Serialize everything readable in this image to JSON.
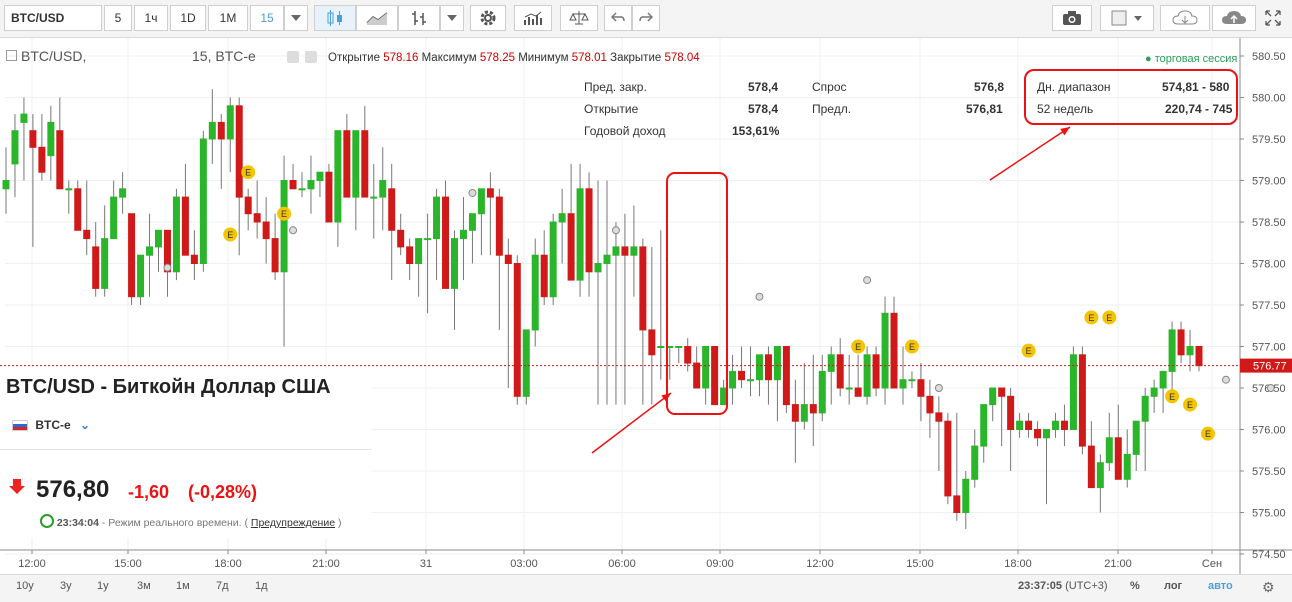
{
  "toolbar": {
    "symbol": "BTC/USD",
    "intervals": [
      "5",
      "1ч",
      "1D",
      "1M",
      "15"
    ],
    "selected_interval": "15",
    "icons": [
      "dropdown-icon",
      "candles-icon",
      "line-chart-icon",
      "bars-icon",
      "dropdown-icon",
      "settings-icon",
      "volume-icon",
      "compare-icon",
      "undo-icon",
      "redo-icon",
      "camera-icon",
      "color-square-icon",
      "cloud-load-icon",
      "cloud-save-icon",
      "fullscreen-icon"
    ]
  },
  "legend": {
    "name": "BTC/USD,",
    "interval_source": "15, BTC-e",
    "open_label": "Открытие",
    "open": "578.16",
    "high_label": "Максимум",
    "high": "578.25",
    "low_label": "Минимум",
    "low": "578.01",
    "close_label": "Закрытие",
    "close": "578.04",
    "session": "торговая сессия"
  },
  "stats": {
    "col1": [
      {
        "label": "Пред. закр.",
        "value": "578,4"
      },
      {
        "label": "Открытие",
        "value": "578,4"
      },
      {
        "label": "Годовой доход",
        "value": "153,61%"
      }
    ],
    "col2": [
      {
        "label": "Спрос",
        "value": "576,8"
      },
      {
        "label": "Предл.",
        "value": "576,81"
      }
    ],
    "col3": [
      {
        "label": "Дн. диапазон",
        "value": "574,81 - 580"
      },
      {
        "label": "52 недель",
        "value": "220,74 - 745"
      }
    ]
  },
  "info": {
    "title": "BTC/USD - Биткойн Доллар США",
    "exchange": "BTC-e",
    "price": "576,80",
    "change": "-1,60",
    "change_pct": "(-0,28%)",
    "time": "23:34:04",
    "status_text": "- Режим реального времени. (",
    "warning_link": "Предупреждение",
    "status_end": ")"
  },
  "chart_data": {
    "type": "candlestick",
    "y_ticks": [
      "580.50",
      "580.00",
      "579.50",
      "579.00",
      "578.50",
      "578.00",
      "577.50",
      "577.00",
      "576.50",
      "576.00",
      "575.50",
      "575.00",
      "574.50"
    ],
    "x_ticks": [
      "12:00",
      "15:00",
      "18:00",
      "21:00",
      "31",
      "03:00",
      "06:00",
      "09:00",
      "12:00",
      "15:00",
      "18:00",
      "21:00",
      "Сен"
    ],
    "last_price": "576.77",
    "ylim": [
      574.5,
      580.6
    ],
    "event_marker": "E",
    "candles": [
      [
        578.9,
        579.4,
        578.6,
        579.0
      ],
      [
        579.2,
        579.8,
        578.8,
        579.6
      ],
      [
        579.7,
        580.0,
        579.0,
        579.8
      ],
      [
        579.6,
        579.8,
        578.2,
        579.4
      ],
      [
        579.4,
        579.8,
        579.0,
        579.1
      ],
      [
        579.3,
        579.9,
        579.0,
        579.7
      ],
      [
        579.6,
        580.0,
        578.9,
        578.9
      ],
      [
        578.9,
        579.0,
        578.6,
        578.9
      ],
      [
        578.9,
        579.0,
        578.5,
        578.4
      ],
      [
        578.4,
        579.0,
        578.1,
        578.3
      ],
      [
        578.2,
        578.5,
        577.6,
        577.7
      ],
      [
        577.7,
        578.7,
        577.6,
        578.3
      ],
      [
        578.3,
        579.0,
        578.3,
        578.8
      ],
      [
        578.8,
        579.1,
        578.6,
        578.9
      ],
      [
        578.6,
        578.6,
        577.5,
        577.6
      ],
      [
        577.6,
        578.1,
        577.5,
        578.1
      ],
      [
        578.1,
        578.6,
        577.6,
        578.2
      ],
      [
        578.2,
        578.4,
        577.9,
        578.4
      ],
      [
        578.4,
        578.4,
        577.6,
        577.9
      ],
      [
        577.9,
        578.9,
        577.8,
        578.8
      ],
      [
        578.8,
        579.2,
        578.1,
        578.1
      ],
      [
        578.1,
        578.4,
        577.8,
        578.0
      ],
      [
        578.0,
        579.6,
        577.9,
        579.5
      ],
      [
        579.5,
        580.1,
        579.2,
        579.7
      ],
      [
        579.7,
        579.8,
        578.9,
        579.5
      ],
      [
        579.5,
        580.0,
        579.1,
        579.9
      ],
      [
        579.9,
        580.0,
        578.1,
        578.8
      ],
      [
        578.8,
        578.9,
        578.4,
        578.6
      ],
      [
        578.6,
        579.0,
        578.3,
        578.5
      ],
      [
        578.5,
        578.8,
        578.0,
        578.3
      ],
      [
        578.3,
        578.6,
        577.8,
        577.9
      ],
      [
        577.9,
        579.3,
        577.0,
        579.0
      ],
      [
        579.0,
        579.2,
        578.9,
        578.9
      ],
      [
        578.9,
        579.1,
        578.8,
        578.9
      ],
      [
        578.9,
        579.3,
        578.6,
        579.0
      ],
      [
        579.0,
        579.1,
        578.8,
        579.1
      ],
      [
        579.1,
        579.2,
        578.5,
        578.5
      ],
      [
        578.5,
        579.6,
        578.2,
        579.6
      ],
      [
        579.6,
        579.8,
        578.8,
        578.8
      ],
      [
        578.8,
        579.6,
        578.4,
        579.6
      ],
      [
        579.6,
        579.9,
        578.8,
        578.8
      ],
      [
        578.8,
        579.2,
        578.3,
        578.8
      ],
      [
        578.8,
        579.4,
        578.4,
        579.0
      ],
      [
        578.9,
        579.2,
        577.8,
        578.4
      ],
      [
        578.4,
        578.6,
        578.1,
        578.2
      ],
      [
        578.2,
        578.3,
        577.8,
        578.0
      ],
      [
        578.0,
        578.3,
        577.6,
        578.3
      ],
      [
        578.3,
        578.6,
        577.4,
        578.3
      ],
      [
        578.3,
        578.9,
        577.8,
        578.8
      ],
      [
        578.8,
        579.0,
        577.7,
        577.7
      ],
      [
        577.7,
        578.4,
        577.2,
        578.3
      ],
      [
        578.3,
        578.8,
        577.8,
        578.4
      ],
      [
        578.4,
        578.5,
        578.0,
        578.6
      ],
      [
        578.6,
        578.9,
        578.1,
        578.9
      ],
      [
        578.9,
        579.1,
        578.1,
        578.8
      ],
      [
        578.8,
        578.9,
        577.2,
        578.1
      ],
      [
        578.1,
        578.3,
        576.5,
        578.0
      ],
      [
        578.0,
        578.1,
        576.3,
        576.4
      ],
      [
        576.4,
        577.1,
        576.3,
        577.2
      ],
      [
        577.2,
        578.3,
        577.0,
        578.1
      ],
      [
        578.1,
        578.4,
        577.5,
        577.6
      ],
      [
        577.6,
        578.6,
        577.5,
        578.5
      ],
      [
        578.5,
        578.9,
        578.0,
        578.6
      ],
      [
        578.6,
        579.2,
        577.8,
        577.8
      ],
      [
        577.8,
        579.2,
        577.6,
        578.9
      ],
      [
        578.9,
        579.1,
        577.6,
        577.9
      ],
      [
        577.9,
        579.0,
        576.3,
        578.0
      ],
      [
        578.0,
        579.0,
        576.3,
        578.1
      ],
      [
        578.1,
        578.5,
        576.3,
        578.2
      ],
      [
        578.2,
        578.6,
        576.3,
        578.1
      ],
      [
        578.1,
        578.7,
        577.6,
        578.2
      ],
      [
        578.2,
        578.3,
        576.3,
        577.2
      ],
      [
        577.2,
        578.2,
        576.3,
        576.9
      ],
      [
        577.0,
        578.4,
        576.6,
        577.0
      ],
      [
        577.0,
        577.0,
        576.6,
        577.0
      ],
      [
        577.0,
        577.0,
        576.8,
        577.0
      ],
      [
        577.0,
        577.1,
        576.7,
        576.8
      ],
      [
        576.8,
        577.0,
        576.5,
        576.5
      ],
      [
        576.5,
        577.0,
        576.3,
        577.0
      ],
      [
        577.0,
        577.0,
        576.4,
        576.3
      ],
      [
        576.3,
        576.6,
        576.3,
        576.5
      ],
      [
        576.5,
        576.9,
        576.3,
        576.7
      ],
      [
        576.7,
        577.0,
        576.5,
        576.6
      ],
      [
        576.6,
        577.0,
        576.4,
        576.6
      ],
      [
        576.6,
        576.7,
        576.4,
        576.9
      ],
      [
        576.9,
        577.0,
        576.3,
        576.6
      ],
      [
        576.6,
        577.0,
        576.1,
        577.0
      ],
      [
        577.0,
        577.0,
        576.2,
        576.3
      ],
      [
        576.3,
        576.6,
        575.6,
        576.1
      ],
      [
        576.1,
        576.8,
        576.0,
        576.3
      ],
      [
        576.3,
        576.9,
        575.8,
        576.2
      ],
      [
        576.2,
        576.9,
        576.1,
        576.7
      ],
      [
        576.7,
        577.0,
        576.3,
        576.9
      ],
      [
        576.9,
        577.1,
        576.4,
        576.5
      ],
      [
        576.5,
        576.9,
        576.3,
        576.5
      ],
      [
        576.5,
        576.9,
        576.4,
        576.4
      ],
      [
        576.4,
        577.0,
        576.3,
        576.9
      ],
      [
        576.9,
        577.0,
        576.4,
        576.5
      ],
      [
        576.5,
        577.6,
        576.3,
        577.4
      ],
      [
        577.4,
        577.6,
        576.5,
        576.5
      ],
      [
        576.5,
        577.0,
        576.3,
        576.6
      ],
      [
        576.6,
        576.7,
        576.5,
        576.6
      ],
      [
        576.6,
        576.8,
        576.1,
        576.4
      ],
      [
        576.4,
        576.6,
        575.9,
        576.2
      ],
      [
        576.2,
        576.4,
        575.5,
        576.1
      ],
      [
        576.1,
        576.2,
        575.1,
        575.2
      ],
      [
        575.2,
        576.2,
        574.9,
        575.0
      ],
      [
        575.0,
        575.5,
        574.8,
        575.4
      ],
      [
        575.4,
        576.0,
        575.3,
        575.8
      ],
      [
        575.8,
        576.3,
        575.6,
        576.3
      ],
      [
        576.3,
        576.5,
        576.1,
        576.5
      ],
      [
        576.5,
        576.5,
        575.8,
        576.4
      ],
      [
        576.4,
        576.5,
        575.5,
        576.0
      ],
      [
        576.0,
        576.2,
        575.9,
        576.1
      ],
      [
        576.1,
        576.2,
        575.9,
        576.0
      ],
      [
        576.0,
        576.1,
        575.8,
        575.9
      ],
      [
        575.9,
        576.0,
        575.1,
        576.0
      ],
      [
        576.0,
        576.2,
        575.9,
        576.1
      ],
      [
        576.1,
        576.3,
        575.8,
        576.0
      ],
      [
        576.0,
        577.0,
        576.0,
        576.9
      ],
      [
        576.9,
        577.0,
        575.7,
        575.8
      ],
      [
        575.8,
        576.1,
        575.3,
        575.3
      ],
      [
        575.3,
        575.7,
        575.0,
        575.6
      ],
      [
        575.6,
        576.2,
        575.5,
        575.9
      ],
      [
        575.9,
        576.3,
        575.5,
        575.4
      ],
      [
        575.4,
        576.0,
        575.3,
        575.7
      ],
      [
        575.7,
        576.0,
        575.5,
        576.1
      ],
      [
        576.1,
        576.5,
        575.5,
        576.4
      ],
      [
        576.4,
        576.6,
        576.2,
        576.5
      ],
      [
        576.5,
        576.7,
        576.2,
        576.7
      ],
      [
        576.7,
        577.3,
        576.4,
        577.2
      ],
      [
        577.2,
        577.3,
        576.8,
        576.9
      ],
      [
        576.9,
        577.2,
        576.7,
        577.0
      ],
      [
        577.0,
        577.0,
        576.7,
        576.77
      ]
    ]
  },
  "bottom": {
    "ranges": [
      "10y",
      "3у",
      "1у",
      "3м",
      "1м",
      "7д",
      "1д"
    ],
    "clock": "23:37:05",
    "tz": "(UTC+3)",
    "pct": "%",
    "log": "лог",
    "auto": "авто"
  }
}
